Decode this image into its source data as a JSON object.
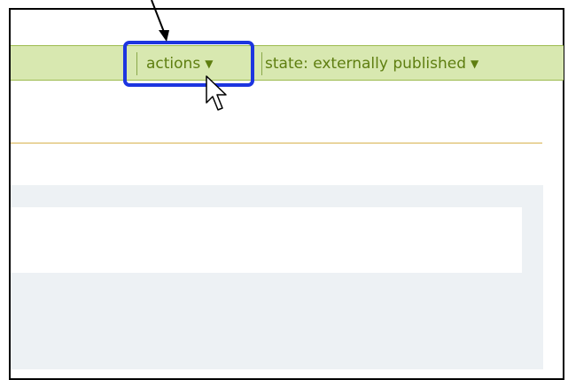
{
  "menubar": {
    "actions_label": "actions",
    "state_label": "state: externally published",
    "dropdown_glyph": "▼"
  },
  "annotation": {
    "highlight_color": "#1d35e0",
    "arrow_color": "#000000"
  },
  "colors": {
    "bar_bg": "#d8e8b0",
    "bar_text": "#5e7e10",
    "divider": "#d7b24f",
    "panel_bg": "#edf1f4"
  }
}
